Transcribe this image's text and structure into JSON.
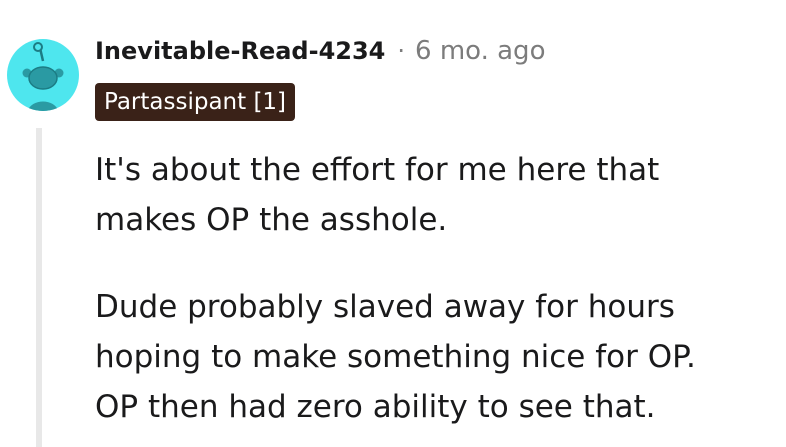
{
  "comment": {
    "username": "Inevitable-Read-4234",
    "separator": "·",
    "timestamp": "6 mo. ago",
    "flair": "Partassipant [1]",
    "avatar_icon": "snoo-avatar-icon",
    "paragraphs": [
      [
        "It's about the effort for me here that",
        "makes OP the asshole."
      ],
      [
        "Dude probably slaved away for hours",
        "hoping to make something nice for OP.",
        "OP then had zero ability to see that."
      ]
    ]
  },
  "colors": {
    "avatar_bg": "#4ee6ee",
    "flair_bg": "#3a2218",
    "meta_text": "#7c7c7c",
    "body_text": "#1a1a1b",
    "thread_line": "#e8e8e8"
  }
}
